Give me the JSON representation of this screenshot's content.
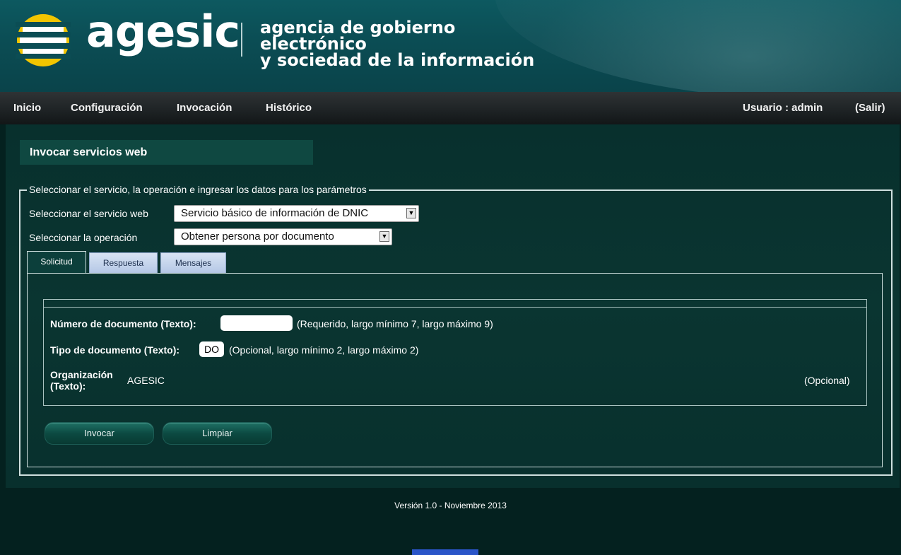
{
  "header": {
    "logo_text": "agesic",
    "tagline_line1": "agencia de gobierno electrónico",
    "tagline_line2": "y sociedad de la información",
    "brand_yellow": "#f2c500",
    "brand_teal": "#0b4d54"
  },
  "nav": {
    "items": [
      {
        "label": "Inicio"
      },
      {
        "label": "Configuración"
      },
      {
        "label": "Invocación"
      },
      {
        "label": "Histórico"
      }
    ],
    "user_label": "Usuario : admin",
    "logout_label": "(Salir)"
  },
  "main": {
    "title": "Invocar servicios web",
    "legend": "Seleccionar el servicio, la operación e ingresar los datos para los parámetros",
    "service_label": "Seleccionar el servicio web",
    "service_value": "Servicio básico de información de DNIC",
    "operation_label": "Seleccionar la operación",
    "operation_value": "Obtener persona por documento",
    "tabs": [
      {
        "label": "Solicitud",
        "active": true
      },
      {
        "label": "Respuesta",
        "active": false
      },
      {
        "label": "Mensajes",
        "active": false
      }
    ],
    "params": {
      "doc_number_label": "Número de documento (Texto):",
      "doc_number_value": "",
      "doc_number_note": "(Requerido, largo mínimo 7, largo máximo 9)",
      "doc_type_label": "Tipo de documento (Texto):",
      "doc_type_value": "DO",
      "doc_type_note": "(Opcional, largo mínimo 2, largo máximo 2)",
      "org_label_line1": "Organización",
      "org_label_line2": "(Texto):",
      "org_value": "AGESIC",
      "org_note": "(Opcional)"
    },
    "buttons": {
      "invoke": "Invocar",
      "clear": "Limpiar"
    }
  },
  "footer": {
    "version": "Versión 1.0 - Noviembre 2013"
  }
}
